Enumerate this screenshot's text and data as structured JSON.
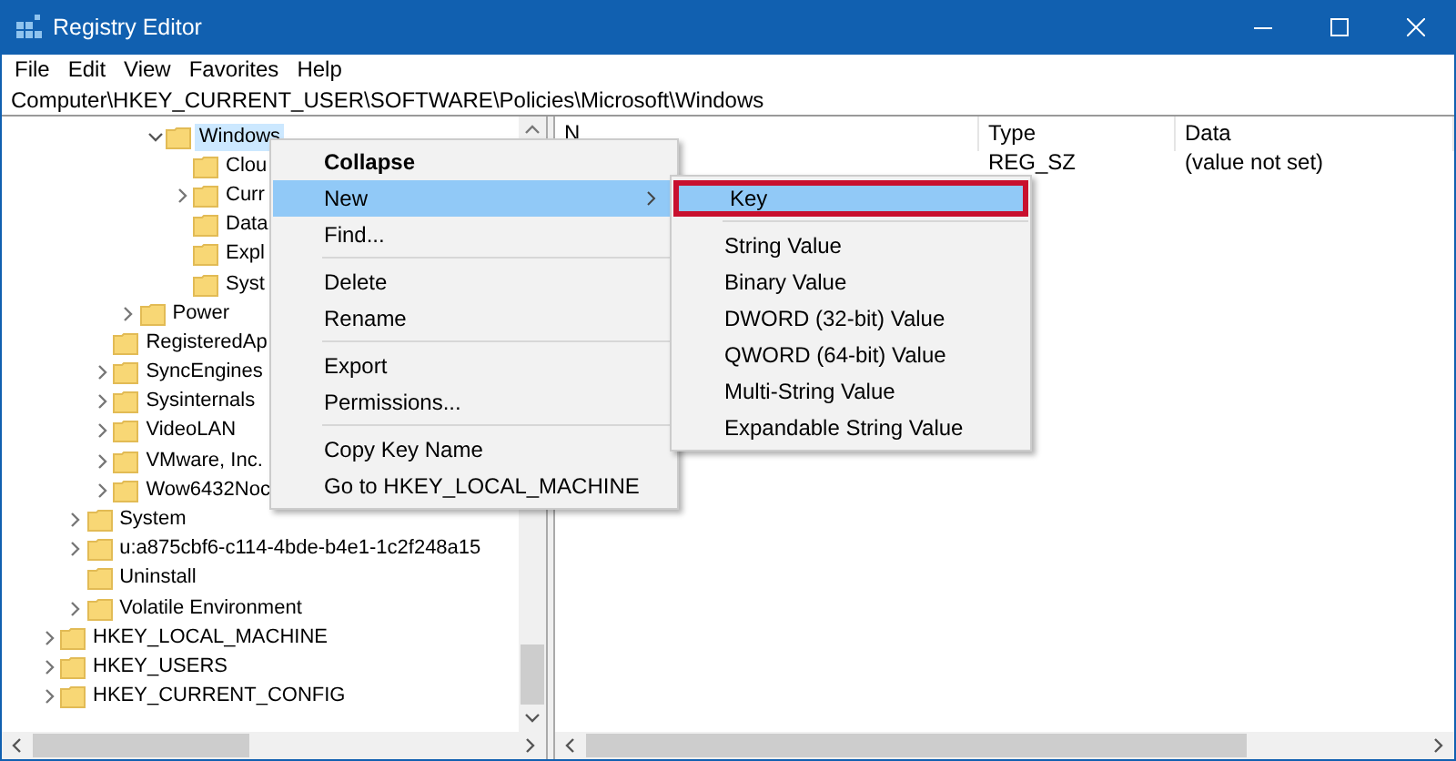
{
  "window": {
    "title": "Registry Editor"
  },
  "menu_bar": [
    "File",
    "Edit",
    "View",
    "Favorites",
    "Help"
  ],
  "address_bar": {
    "value": "Computer\\HKEY_CURRENT_USER\\SOFTWARE\\Policies\\Microsoft\\Windows"
  },
  "tree": [
    {
      "children": [
        {
          "children": [
            {
              "children": [
                {
                  "children": [
                    {
                      "label": "Windows",
                      "expandable": true,
                      "expanded": true,
                      "selected": true,
                      "children": [
                        {
                          "label": "Clou",
                          "expandable": false,
                          "expanded": false,
                          "selected": false
                        },
                        {
                          "label": "Curr",
                          "expandable": true,
                          "expanded": false,
                          "selected": false
                        },
                        {
                          "label": "Data",
                          "expandable": false,
                          "expanded": false,
                          "selected": false
                        },
                        {
                          "label": "Expl",
                          "expandable": false,
                          "expanded": false,
                          "selected": false
                        },
                        {
                          "label": "Syst",
                          "expandable": false,
                          "expanded": false,
                          "selected": false
                        }
                      ]
                    }
                  ]
                },
                {
                  "label": "Power",
                  "expandable": true,
                  "expanded": false,
                  "selected": false
                }
              ]
            },
            {
              "label": "RegisteredAp",
              "expandable": false,
              "expanded": false,
              "selected": false
            },
            {
              "label": "SyncEngines",
              "expandable": true,
              "expanded": false,
              "selected": false
            },
            {
              "label": "Sysinternals",
              "expandable": true,
              "expanded": false,
              "selected": false
            },
            {
              "label": "VideoLAN",
              "expandable": true,
              "expanded": false,
              "selected": false
            },
            {
              "label": "VMware, Inc.",
              "expandable": true,
              "expanded": false,
              "selected": false
            },
            {
              "label": "Wow6432Noc",
              "expandable": true,
              "expanded": false,
              "selected": false
            }
          ]
        },
        {
          "label": "System",
          "expandable": true,
          "expanded": false,
          "selected": false
        },
        {
          "label": "u:a875cbf6-c114-4bde-b4e1-1c2f248a15",
          "expandable": true,
          "expanded": false,
          "selected": false
        },
        {
          "label": "Uninstall",
          "expandable": false,
          "expanded": false,
          "selected": false
        },
        {
          "label": "Volatile Environment",
          "expandable": true,
          "expanded": false,
          "selected": false
        }
      ]
    },
    {
      "label": "HKEY_LOCAL_MACHINE",
      "expandable": true,
      "expanded": false,
      "selected": false
    },
    {
      "label": "HKEY_USERS",
      "expandable": true,
      "expanded": false,
      "selected": false
    },
    {
      "label": "HKEY_CURRENT_CONFIG",
      "expandable": true,
      "expanded": false,
      "selected": false
    }
  ],
  "values": {
    "columns": [
      "N",
      "Type",
      "Data"
    ],
    "rows": [
      {
        "type": "REG_SZ",
        "data": "(value not set)"
      }
    ]
  },
  "context_menu": [
    {
      "kind": "item",
      "label": "Collapse",
      "default": true,
      "selected": false,
      "submenu": false
    },
    {
      "kind": "item",
      "label": "New",
      "default": false,
      "selected": true,
      "submenu": true
    },
    {
      "kind": "item",
      "label": "Find...",
      "default": false,
      "selected": false,
      "submenu": false
    },
    {
      "kind": "separator"
    },
    {
      "kind": "item",
      "label": "Delete",
      "default": false,
      "selected": false,
      "submenu": false
    },
    {
      "kind": "item",
      "label": "Rename",
      "default": false,
      "selected": false,
      "submenu": false
    },
    {
      "kind": "separator"
    },
    {
      "kind": "item",
      "label": "Export",
      "default": false,
      "selected": false,
      "submenu": false
    },
    {
      "kind": "item",
      "label": "Permissions...",
      "default": false,
      "selected": false,
      "submenu": false
    },
    {
      "kind": "separator"
    },
    {
      "kind": "item",
      "label": "Copy Key Name",
      "default": false,
      "selected": false,
      "submenu": false
    },
    {
      "kind": "item",
      "label": "Go to HKEY_LOCAL_MACHINE",
      "default": false,
      "selected": false,
      "submenu": false
    }
  ],
  "submenu": [
    {
      "kind": "item",
      "label": "Key",
      "selected": true,
      "annotated": true
    },
    {
      "kind": "separator"
    },
    {
      "kind": "item",
      "label": "String Value",
      "selected": false,
      "annotated": false
    },
    {
      "kind": "item",
      "label": "Binary Value",
      "selected": false,
      "annotated": false
    },
    {
      "kind": "item",
      "label": "DWORD (32-bit) Value",
      "selected": false,
      "annotated": false
    },
    {
      "kind": "item",
      "label": "QWORD (64-bit) Value",
      "selected": false,
      "annotated": false
    },
    {
      "kind": "item",
      "label": "Multi-String Value",
      "selected": false,
      "annotated": false
    },
    {
      "kind": "item",
      "label": "Expandable String Value",
      "selected": false,
      "annotated": false
    }
  ]
}
